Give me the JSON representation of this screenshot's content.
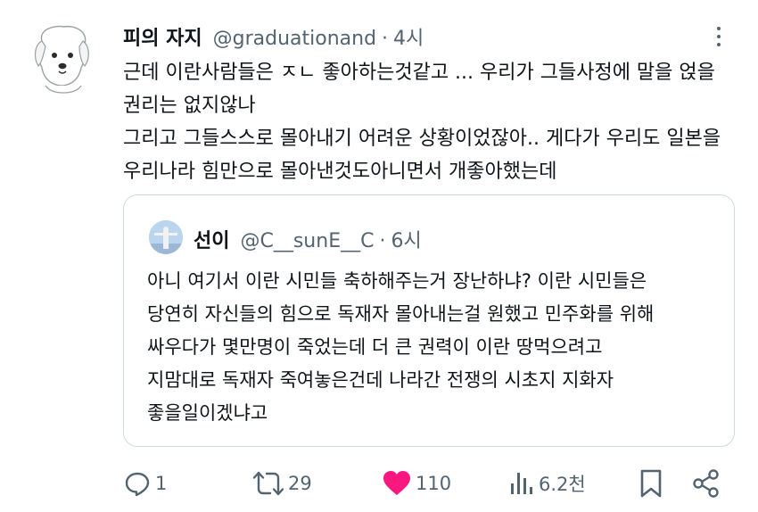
{
  "author": {
    "display_name": "피의 자지",
    "handle": "@graduationand",
    "separator": "·",
    "time": "4시"
  },
  "body_lines": [
    "근데 이란사람들은 ㅈㄴ 좋아하는것같고 ... 우리가 그들사정에 말을 얹을",
    "권리는 없지않나",
    "그리고 그들스스로 몰아내기 어려운 상황이었잖아.. 게다가 우리도 일본을",
    "우리나라 힘만으로 몰아낸것도아니면서 개좋아했는데"
  ],
  "quoted": {
    "display_name": "선이",
    "handle": "@C__sunE__C",
    "separator": "·",
    "time": "6시",
    "body_lines": [
      "아니 여기서 이란 시민들 축하해주는거 장난하냐? 이란 시민들은",
      "당연히 자신들의 힘으로 독재자 몰아내는걸 원했고 민주화를 위해",
      "싸우다가 몇만명이 죽었는데 더 큰 권력이 이란 땅먹으려고",
      "지맘대로 독재자 죽여놓은건데 나라간 전쟁의 시초지 지화자",
      "좋을일이겠냐고"
    ]
  },
  "actions": {
    "replies": "1",
    "reposts": "29",
    "likes": "110",
    "views": "6.2천"
  },
  "colors": {
    "text": "#0f1419",
    "secondary": "#536471",
    "like": "#f91880",
    "border": "#cfd9de"
  },
  "icons": [
    "more-icon",
    "reply-icon",
    "repost-icon",
    "like-icon",
    "views-icon",
    "bookmark-icon",
    "share-icon"
  ]
}
